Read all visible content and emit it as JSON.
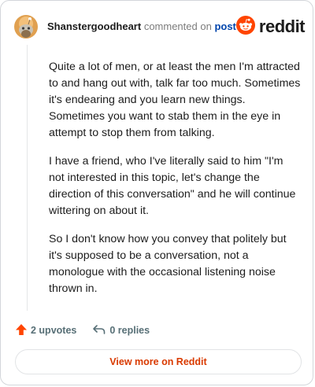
{
  "comment": {
    "username": "Shanstergoodheart",
    "action_text": "commented on",
    "post_link": "post",
    "paragraphs": [
      "Quite a lot of men, or at least the men I'm attracted to and hang out with, talk far too much. Sometimes it's endearing and you learn new things. Sometimes you want to stab them in the eye in attempt to stop them from talking.",
      "I have a friend, who I've literally said to him \"I'm not interested in this topic, let's change the direction of this conversation\" and he will continue wittering on about it.",
      "So I don't know how you convey that politely but it's supposed to be a conversation, not a monologue with the occasional listening noise thrown in."
    ]
  },
  "brand": {
    "wordmark": "reddit",
    "icon": "reddit-snoo-icon",
    "color": "#ff4500"
  },
  "footer": {
    "upvotes": "2 upvotes",
    "replies": "0 replies",
    "view_more": "View more on Reddit",
    "upvote_icon": "upvote-arrow-icon",
    "reply_icon": "reply-arrow-icon",
    "accent": "#d93a00"
  }
}
